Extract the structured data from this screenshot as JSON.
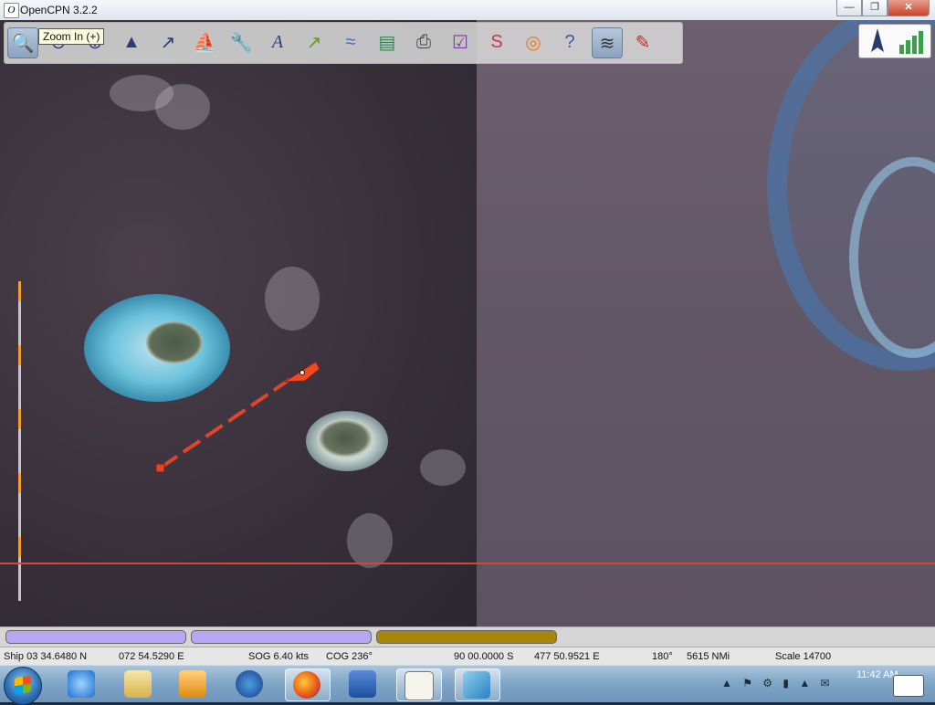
{
  "window": {
    "title": "OpenCPN 3.2.2",
    "app_icon": "O",
    "controls": {
      "minimize": "—",
      "maximize": "❐",
      "close": "✕"
    }
  },
  "toolbar": {
    "tooltip": "Zoom In (+)",
    "tools": [
      {
        "name": "zoom-in-icon",
        "glyph": "🔍"
      },
      {
        "name": "zoom-out-icon",
        "glyph": "⊖"
      },
      {
        "name": "scale-in-icon",
        "glyph": "⊕"
      },
      {
        "name": "scale-out-icon",
        "glyph": "▲"
      },
      {
        "name": "route-icon",
        "glyph": "↗"
      },
      {
        "name": "auto-follow-icon",
        "glyph": "⛵"
      },
      {
        "name": "options-icon",
        "glyph": "🔧"
      },
      {
        "name": "text-icon",
        "glyph": "A"
      },
      {
        "name": "current-icon",
        "glyph": "↗"
      },
      {
        "name": "tide-icon",
        "glyph": "≈"
      },
      {
        "name": "chart-quilt-icon",
        "glyph": "▤"
      },
      {
        "name": "print-icon",
        "glyph": "⎙"
      },
      {
        "name": "route-manager-icon",
        "glyph": "☑"
      },
      {
        "name": "track-icon",
        "glyph": "S"
      },
      {
        "name": "mob-icon",
        "glyph": "◎"
      },
      {
        "name": "help-icon",
        "glyph": "?"
      },
      {
        "name": "ais-icon",
        "glyph": "≋"
      },
      {
        "name": "plugin-icon",
        "glyph": "✎"
      }
    ]
  },
  "status": {
    "ship": "Ship 03 34.6480 N",
    "ship_lon": "072 54.5290 E",
    "sog": "SOG 6.40 kts",
    "cog": "COG 236°",
    "cursor_lat": "90 00.0000 S",
    "cursor_lon": "477 50.9521 E",
    "bearing": "180°",
    "distance": "5615 NMi",
    "scale": "Scale 14700"
  },
  "piano": [
    {
      "color": "#b7a6f2"
    },
    {
      "color": "#b7a6f2"
    },
    {
      "color": "#a8860c"
    }
  ],
  "taskbar": {
    "apps": [
      "internet-explorer-icon",
      "file-explorer-icon",
      "media-player-icon",
      "globe-icon",
      "firefox-icon",
      "word-icon",
      "opencpn-icon",
      "chart-app-icon"
    ],
    "clock": "11:42 AM"
  },
  "colors": {
    "ownship": "#e0452a",
    "scale_segment": "#f0a030"
  }
}
